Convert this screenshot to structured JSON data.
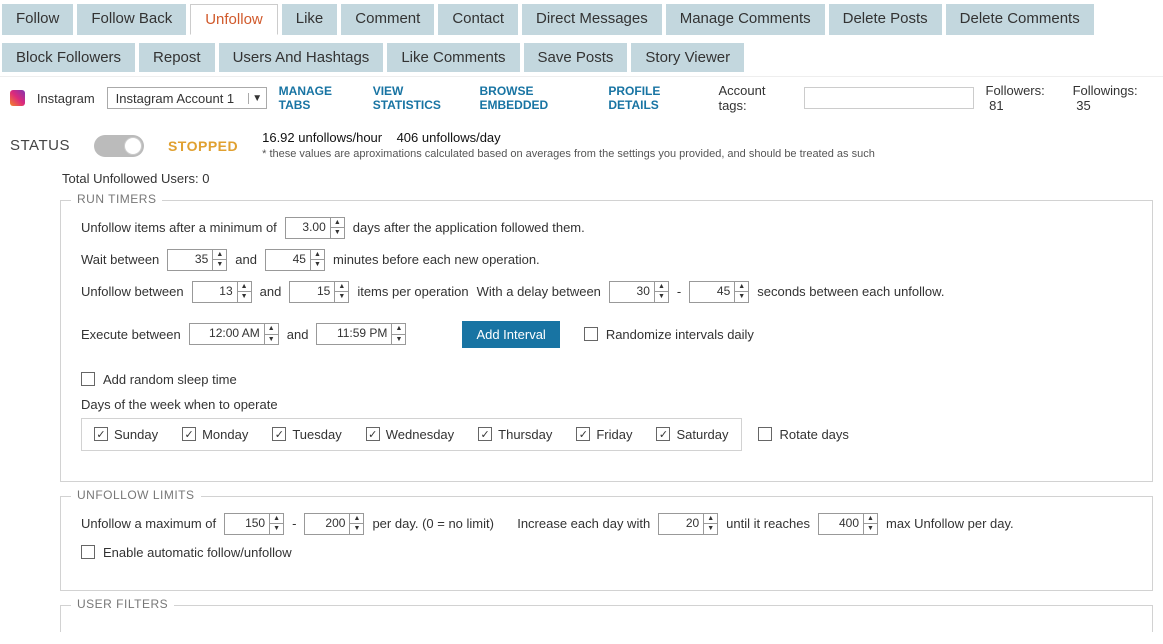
{
  "tabs_row1": [
    "Follow",
    "Follow Back",
    "Unfollow",
    "Like",
    "Comment",
    "Contact",
    "Direct Messages",
    "Manage Comments",
    "Delete Posts",
    "Delete Comments"
  ],
  "tabs_row2": [
    "Block Followers",
    "Repost",
    "Users And Hashtags",
    "Like Comments",
    "Save Posts",
    "Story Viewer"
  ],
  "active_tab": "Unfollow",
  "toolbar": {
    "platform": "Instagram",
    "account_selected": "Instagram Account 1",
    "links": {
      "manage_tabs": "MANAGE TABS",
      "view_stats": "VIEW STATISTICS",
      "browse_embedded": "BROWSE EMBEDDED",
      "profile_details": "PROFILE DETAILS"
    },
    "account_tags_label": "Account tags:",
    "followers_label": "Followers:",
    "followers_value": "81",
    "followings_label": "Followings:",
    "followings_value": "35"
  },
  "status": {
    "label": "STATUS",
    "state": "STOPPED",
    "rate_hour": "16.92",
    "rate_hour_unit": "unfollows/hour",
    "rate_day": "406",
    "rate_day_unit": "unfollows/day",
    "note": "* these values are aproximations calculated based on averages from the settings you provided, and should be treated as such",
    "total_label": "Total Unfollowed Users:",
    "total_value": "0"
  },
  "run_timers": {
    "legend": "RUN TIMERS",
    "l1a": "Unfollow items after a minimum of",
    "l1_val": "3.00",
    "l1b": "days after the application followed them.",
    "l2a": "Wait between",
    "l2_min": "35",
    "l2_and": "and",
    "l2_max": "45",
    "l2b": "minutes before each new operation.",
    "l3a": "Unfollow between",
    "l3_min": "13",
    "l3_and": "and",
    "l3_max": "15",
    "l3b": "items per operation",
    "l3c": "With a delay between",
    "l3_dmin": "30",
    "l3_dash": "-",
    "l3_dmax": "45",
    "l3d": "seconds between each unfollow.",
    "l4a": "Execute between",
    "l4_start": "12:00 AM",
    "l4_and": "and",
    "l4_end": "11:59 PM",
    "add_interval": "Add Interval",
    "randomize": "Randomize intervals daily",
    "add_sleep": "Add random sleep time",
    "days_label": "Days of the week when to operate",
    "days": [
      "Sunday",
      "Monday",
      "Tuesday",
      "Wednesday",
      "Thursday",
      "Friday",
      "Saturday"
    ],
    "rotate": "Rotate days"
  },
  "unfollow_limits": {
    "legend": "UNFOLLOW LIMITS",
    "l1a": "Unfollow a maximum of",
    "min": "150",
    "dash": "-",
    "max": "200",
    "l1b": "per day. (0 = no limit)",
    "l1c": "Increase each day with",
    "inc": "20",
    "l1d": "until it reaches",
    "cap": "400",
    "l1e": "max Unfollow per day.",
    "auto": "Enable automatic follow/unfollow"
  },
  "user_filters": {
    "legend": "USER FILTERS"
  }
}
